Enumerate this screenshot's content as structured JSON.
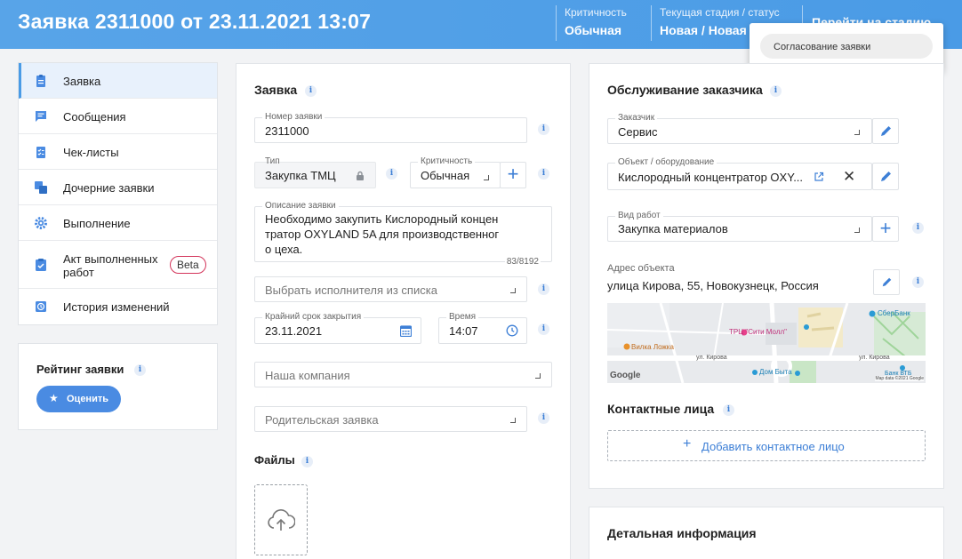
{
  "header": {
    "title": "Заявка 2311000 от 23.11.2021 13:07",
    "criticality_label": "Критичность",
    "criticality_value": "Обычная",
    "stage_label": "Текущая стадия / статус",
    "stage_value": "Новая / Новая",
    "next_stage_button": "Перейти на стадию"
  },
  "dropdown": {
    "option": "Согласование заявки"
  },
  "nav": {
    "items": [
      {
        "label": "Заявка",
        "icon": "clipboard-icon"
      },
      {
        "label": "Сообщения",
        "icon": "message-icon"
      },
      {
        "label": "Чек-листы",
        "icon": "checklist-icon"
      },
      {
        "label": "Дочерние заявки",
        "icon": "child-requests-icon"
      },
      {
        "label": "Выполнение",
        "icon": "gear-icon"
      },
      {
        "label": "Акт выполненных работ",
        "icon": "act-icon"
      },
      {
        "label": "История изменений",
        "icon": "history-icon"
      }
    ],
    "beta_badge": "Beta"
  },
  "rating": {
    "title": "Рейтинг заявки",
    "button": "Оценить"
  },
  "request": {
    "section_title": "Заявка",
    "number_label": "Номер заявки",
    "number_value": "2311000",
    "type_label": "Тип",
    "type_value": "Закупка ТМЦ",
    "criticality_label": "Критичность",
    "criticality_value": "Обычная",
    "description_label": "Описание заявки",
    "description_lines": [
      "Необходимо закупить Кислородный концен",
      "тратор OXYLAND 5A для производственног",
      "о цеха."
    ],
    "description_counter": "83/8192",
    "executor_placeholder": "Выбрать исполнителя из списка",
    "deadline_label": "Крайний срок закрытия",
    "deadline_value": "23.11.2021",
    "time_label": "Время",
    "time_value": "14:07",
    "company_placeholder": "Наша компания",
    "parent_placeholder": "Родительская заявка",
    "files_title": "Файлы"
  },
  "customer": {
    "section_title": "Обслуживание заказчика",
    "customer_label": "Заказчик",
    "customer_value": "Сервис",
    "object_label": "Объект / оборудование",
    "object_value": "Кислородный концентратор OXY...",
    "work_type_label": "Вид работ",
    "work_type_value": "Закупка материалов",
    "address_label": "Адрес объекта",
    "address_value": "улица Кирова, 55, Новокузнецк, Россия",
    "map_labels": {
      "mall": "ТРЦ \"Сити Молл\"",
      "fork": "Вилка Ложка",
      "bank": "СберБанк",
      "street1": "ул. Кирова",
      "street2": "ул. Кирова",
      "house": "Дом Быта",
      "google": "Google",
      "copyright": "Map data ©2021 Google",
      "vtb": "Банк ВТБ"
    },
    "contacts_title": "Контактные лица",
    "add_contact": "Добавить контактное лицо"
  },
  "details": {
    "section_title": "Детальная информация"
  },
  "colors": {
    "header": "#4a9be6",
    "accent": "#3d7fd6",
    "beta_border": "#d3345a"
  }
}
